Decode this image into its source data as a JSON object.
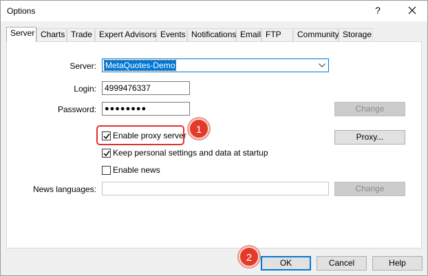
{
  "window": {
    "title": "Options",
    "help_label": "?"
  },
  "tabs": [
    {
      "label": "Server",
      "active": true
    },
    {
      "label": "Charts"
    },
    {
      "label": "Trade"
    },
    {
      "label": "Expert Advisors"
    },
    {
      "label": "Events"
    },
    {
      "label": "Notifications"
    },
    {
      "label": "Email"
    },
    {
      "label": "FTP"
    },
    {
      "label": "Community"
    },
    {
      "label": "Storage"
    }
  ],
  "server": {
    "server_label": "Server:",
    "server_value": "MetaQuotes-Demo",
    "login_label": "Login:",
    "login_value": "4999476337",
    "password_label": "Password:",
    "password_value": "●●●●●●●●",
    "change_password_label": "Change",
    "proxy_checkbox": {
      "label": "Enable proxy server",
      "checked": true
    },
    "proxy_button_label": "Proxy...",
    "keep_settings_checkbox": {
      "label": "Keep personal settings and data at startup",
      "checked": true
    },
    "news_checkbox": {
      "label": "Enable news",
      "checked": false
    },
    "news_languages_label": "News languages:",
    "news_languages_value": "",
    "change_news_label": "Change"
  },
  "annotations": {
    "marker_1": "1",
    "marker_2": "2",
    "highlight_color": "#e03030",
    "marker_color": "#e53a2a"
  },
  "footer": {
    "ok_label": "OK",
    "cancel_label": "Cancel",
    "help_label": "Help"
  },
  "colors": {
    "accent": "#0078d7",
    "panel": "#ffffff",
    "background": "#f0f0f0"
  }
}
